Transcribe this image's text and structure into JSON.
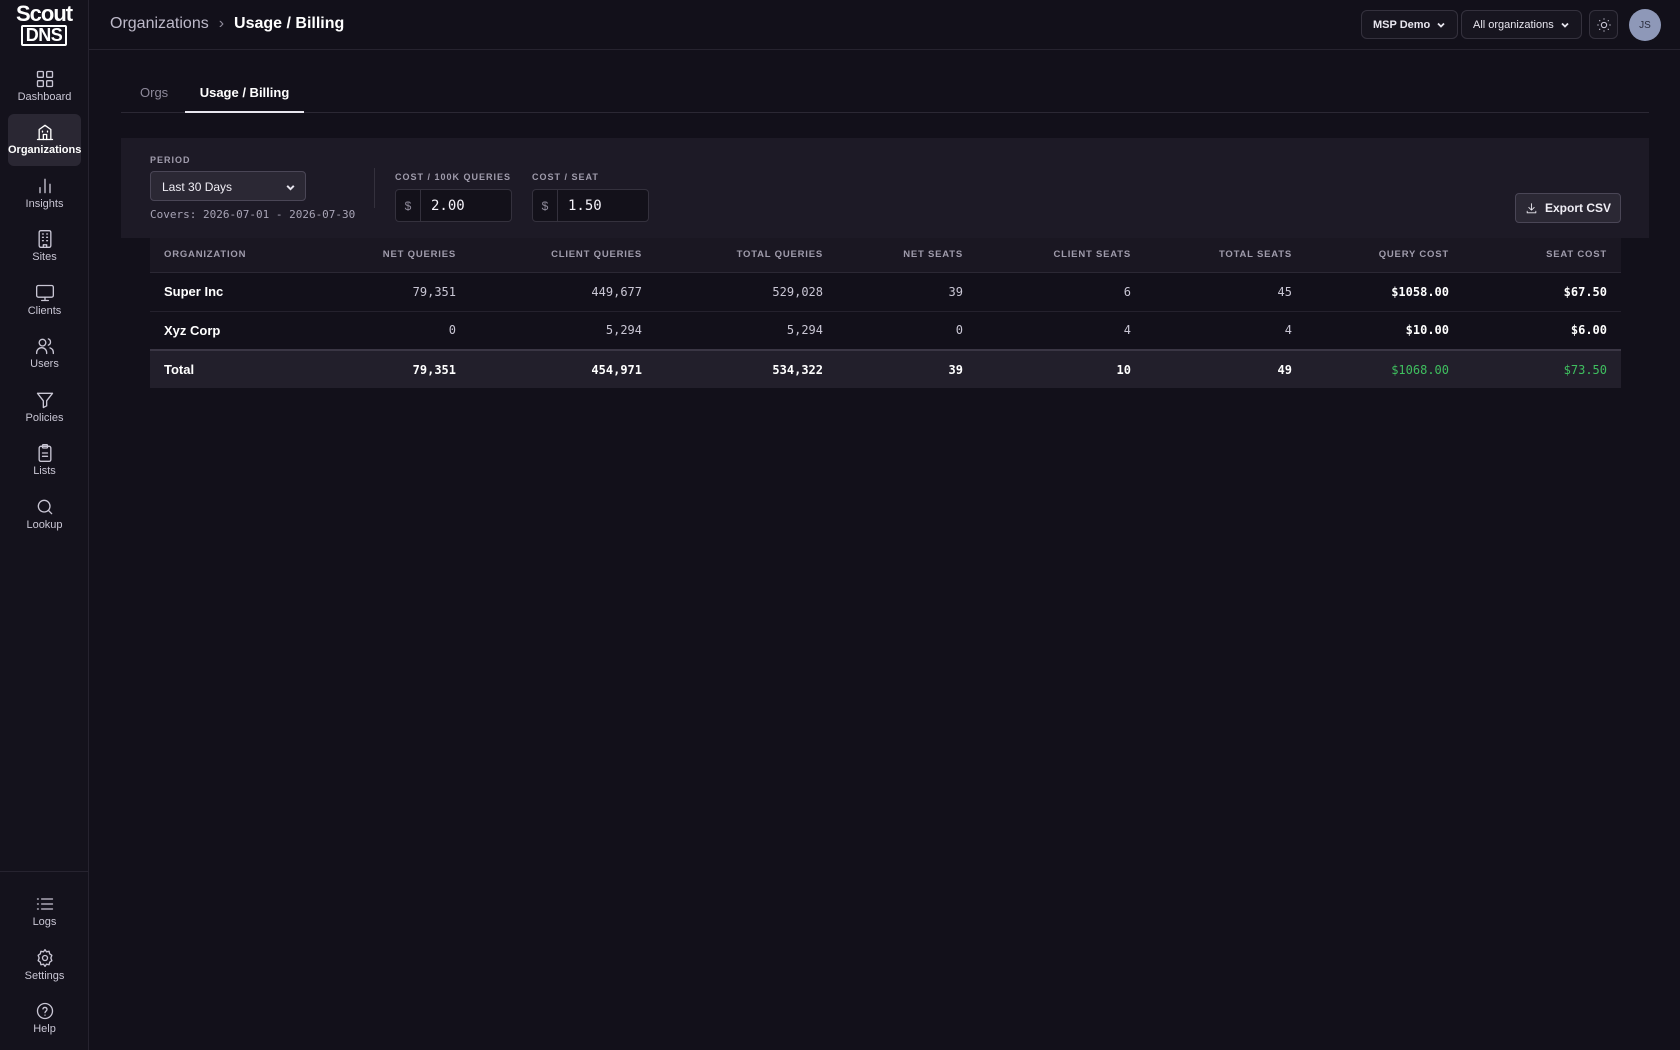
{
  "app": {
    "logo_line1": "Scout",
    "logo_line2": "DNS"
  },
  "sidebar": {
    "items": [
      {
        "label": "Dashboard",
        "icon": "grid-icon"
      },
      {
        "label": "Organizations",
        "icon": "building-icon",
        "active": true
      },
      {
        "label": "Insights",
        "icon": "bar-chart-icon"
      },
      {
        "label": "Sites",
        "icon": "building-windows-icon"
      },
      {
        "label": "Clients",
        "icon": "monitor-icon"
      },
      {
        "label": "Users",
        "icon": "users-icon"
      },
      {
        "label": "Policies",
        "icon": "filter-icon"
      },
      {
        "label": "Lists",
        "icon": "clipboard-icon"
      },
      {
        "label": "Lookup",
        "icon": "search-icon"
      }
    ],
    "bottom_items": [
      {
        "label": "Logs",
        "icon": "list-icon"
      },
      {
        "label": "Settings",
        "icon": "gear-icon"
      },
      {
        "label": "Help",
        "icon": "help-circle-icon"
      }
    ]
  },
  "header": {
    "breadcrumb_parent": "Organizations",
    "breadcrumb_separator": "›",
    "breadcrumb_current": "Usage / Billing",
    "tenant_label": "MSP Demo",
    "org_filter_label": "All organizations",
    "avatar_initials": "JS"
  },
  "tabs": [
    {
      "label": "Orgs"
    },
    {
      "label": "Usage / Billing",
      "active": true
    }
  ],
  "filters": {
    "period_label": "PERIOD",
    "period_value": "Last 30 Days",
    "covers_text": "Covers: 2026-07-01 - 2026-07-30",
    "query_cost_label": "COST / 100K QUERIES",
    "query_cost_currency": "$",
    "query_cost_value": "2.00",
    "seat_cost_label": "COST / SEAT",
    "seat_cost_currency": "$",
    "seat_cost_value": "1.50",
    "export_label": "Export CSV"
  },
  "table": {
    "columns": [
      "ORGANIZATION",
      "NET QUERIES",
      "CLIENT QUERIES",
      "TOTAL QUERIES",
      "NET SEATS",
      "CLIENT SEATS",
      "TOTAL SEATS",
      "QUERY COST",
      "SEAT COST"
    ],
    "rows": [
      [
        "Super Inc",
        "79,351",
        "449,677",
        "529,028",
        "39",
        "6",
        "45",
        "$1058.00",
        "$67.50"
      ],
      [
        "Xyz Corp",
        "0",
        "5,294",
        "5,294",
        "0",
        "4",
        "4",
        "$10.00",
        "$6.00"
      ]
    ],
    "total": [
      "Total",
      "79,351",
      "454,971",
      "534,322",
      "39",
      "10",
      "49",
      "$1068.00",
      "$73.50"
    ]
  },
  "colors": {
    "background": "#12101a",
    "panel": "#1d1a26",
    "total_cost_green": "#3fbf5f"
  }
}
